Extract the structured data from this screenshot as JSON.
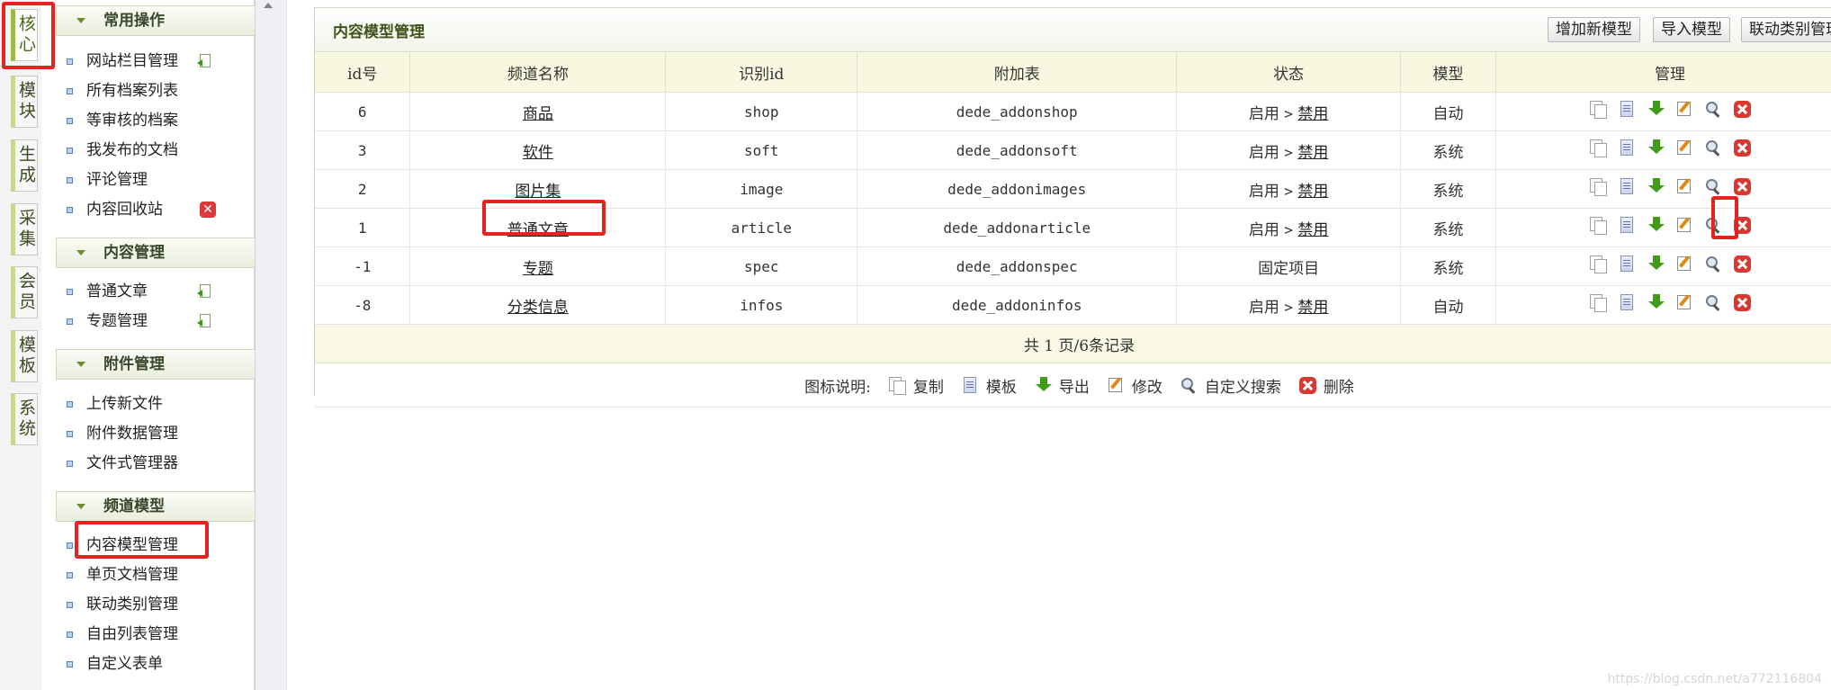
{
  "vtabs": [
    {
      "label": "核心",
      "active": true
    },
    {
      "label": "模块"
    },
    {
      "label": "生成"
    },
    {
      "label": "采集"
    },
    {
      "label": "会员"
    },
    {
      "label": "模板"
    },
    {
      "label": "系统"
    }
  ],
  "sidebar": {
    "groups": [
      {
        "title": "常用操作",
        "items": [
          "网站栏目管理",
          "所有档案列表",
          "等审核的档案",
          "我发布的文档",
          "评论管理",
          "内容回收站"
        ]
      },
      {
        "title": "内容管理",
        "items": [
          "普通文章",
          "专题管理"
        ]
      },
      {
        "title": "附件管理",
        "items": [
          "上传新文件",
          "附件数据管理",
          "文件式管理器"
        ]
      },
      {
        "title": "频道模型",
        "items": [
          "内容模型管理",
          "单页文档管理",
          "联动类别管理",
          "自由列表管理",
          "自定义表单"
        ]
      }
    ]
  },
  "panel": {
    "title": "内容模型管理",
    "buttons": [
      "增加新模型",
      "导入模型",
      "联动类别管理"
    ]
  },
  "table": {
    "headers": [
      "id号",
      "频道名称",
      "识别id",
      "附加表",
      "状态",
      "模型",
      "管理"
    ],
    "rows": [
      {
        "id": "6",
        "name": "商品",
        "nid": "shop",
        "addtable": "dede_addonshop",
        "state_on": "启用",
        "state_sep": ">",
        "state_off": "禁用",
        "model": "自动"
      },
      {
        "id": "3",
        "name": "软件",
        "nid": "soft",
        "addtable": "dede_addonsoft",
        "state_on": "启用",
        "state_sep": ">",
        "state_off": "禁用",
        "model": "系统"
      },
      {
        "id": "2",
        "name": "图片集",
        "nid": "image",
        "addtable": "dede_addonimages",
        "state_on": "启用",
        "state_sep": ">",
        "state_off": "禁用",
        "model": "系统"
      },
      {
        "id": "1",
        "name": "普通文章",
        "nid": "article",
        "addtable": "dede_addonarticle",
        "state_on": "启用",
        "state_sep": ">",
        "state_off": "禁用",
        "model": "系统"
      },
      {
        "id": "-1",
        "name": "专题",
        "nid": "spec",
        "addtable": "dede_addonspec",
        "state_fixed": "固定项目",
        "model": "系统"
      },
      {
        "id": "-8",
        "name": "分类信息",
        "nid": "infos",
        "addtable": "dede_addoninfos",
        "state_on": "启用",
        "state_sep": ">",
        "state_off": "禁用",
        "model": "自动"
      }
    ],
    "pager": "共 1 页/6条记录",
    "legend": {
      "label": "图标说明:",
      "items": [
        {
          "icon": "copy-icon",
          "text": "复制"
        },
        {
          "icon": "template-icon",
          "text": "模板"
        },
        {
          "icon": "export-icon",
          "text": "导出"
        },
        {
          "icon": "edit-icon",
          "text": "修改"
        },
        {
          "icon": "search-icon",
          "text": "自定义搜索"
        },
        {
          "icon": "delete-icon",
          "text": "删除"
        }
      ]
    }
  },
  "watermark": "https://blog.csdn.net/a772116804",
  "colors": {
    "highlight": "#e8231f",
    "menu_head_text": "#38472a",
    "header_bg": "#f8f8e0"
  }
}
